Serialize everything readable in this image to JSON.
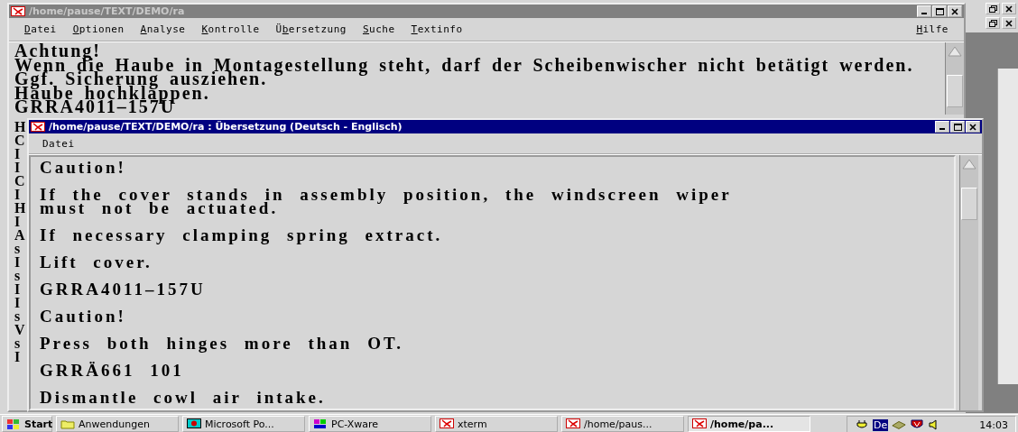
{
  "back_window": {
    "title": "/home/pause/TEXT/DEMO/ra",
    "active": false,
    "menu": [
      {
        "key": "D",
        "after": "atei"
      },
      {
        "key": "O",
        "after": "ptionen"
      },
      {
        "key": "A",
        "after": "nalyse"
      },
      {
        "key": "K",
        "after": "ontrolle"
      },
      {
        "before": "Ü",
        "key": "b",
        "after": "ersetzung"
      },
      {
        "key": "S",
        "after": "uche"
      },
      {
        "key": "T",
        "after": "extinfo"
      }
    ],
    "help_menu": {
      "key": "H",
      "after": "ilfe"
    },
    "lines": [
      "Achtung!",
      "Wenn die Haube in Montagestellung steht, darf der Scheibenwischer nicht betätigt werden.",
      "Ggf. Sicherung ausziehen.",
      "Haube hochklappen.",
      "GRRA4011–157U"
    ],
    "covered_line_starts": [
      "H",
      "C",
      "I",
      "I",
      "C",
      "I",
      "H",
      "I",
      "A",
      "s",
      "I",
      "s",
      "I",
      "I",
      "s",
      "V",
      "s",
      "I"
    ]
  },
  "front_window": {
    "title": "/home/pause/TEXT/DEMO/ra : Übersetzung (Deutsch - Englisch)",
    "active": true,
    "menu": [
      "Datei"
    ],
    "paragraphs": [
      [
        "Caution!"
      ],
      [
        "If the cover stands in assembly position, the windscreen wiper",
        "must not be actuated."
      ],
      [
        "If necessary clamping spring extract."
      ],
      [
        "Lift cover."
      ],
      [
        "GRRA4011–157U"
      ],
      [
        "Caution!"
      ],
      [
        "Press both hinges more than OT."
      ],
      [
        "GRRÄ661 101"
      ],
      [
        "Dismantle cowl air intake."
      ]
    ]
  },
  "taskbar": {
    "start": "Start",
    "tasks": [
      {
        "label": "Anwendungen",
        "kind": "folder",
        "selected": false
      },
      {
        "label": "Microsoft Po...",
        "kind": "presentation",
        "selected": false
      },
      {
        "label": "PC-Xware",
        "kind": "terminal",
        "selected": false
      },
      {
        "label": "xterm",
        "kind": "xwindow",
        "selected": false
      },
      {
        "label": "/home/paus...",
        "kind": "xwindow",
        "selected": false
      },
      {
        "label": "/home/pa...",
        "kind": "xwindow",
        "selected": true
      }
    ],
    "language": "De",
    "clock": "14:03"
  }
}
